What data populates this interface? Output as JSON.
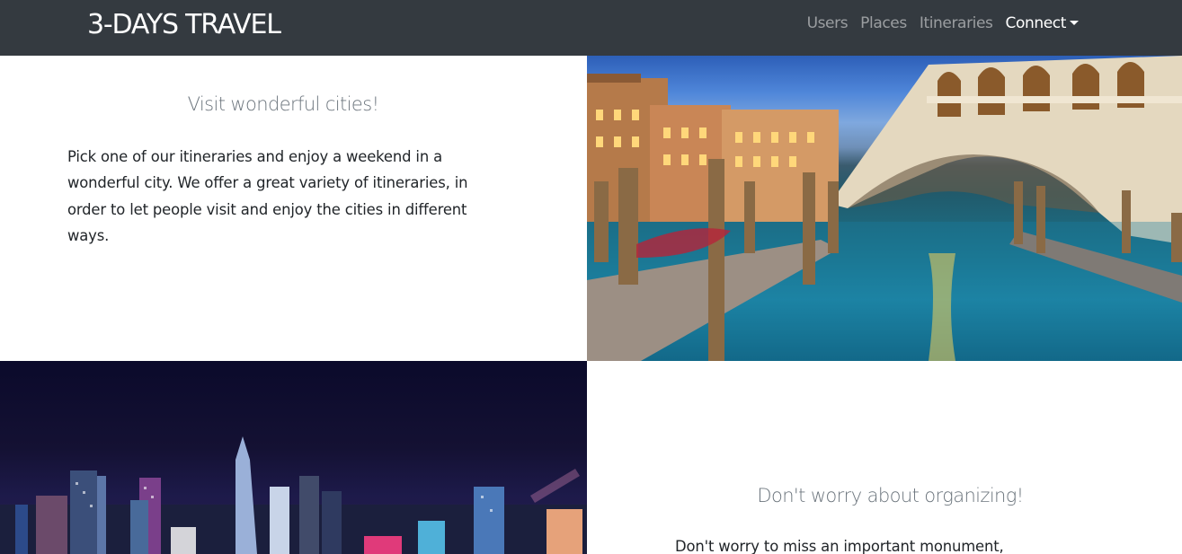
{
  "nav": {
    "brand": "3-DAYS TRAVEL",
    "links": [
      {
        "label": "Users",
        "active": false
      },
      {
        "label": "Places",
        "active": false
      },
      {
        "label": "Itineraries",
        "active": false
      },
      {
        "label": "Connect",
        "active": true,
        "dropdown": true
      }
    ]
  },
  "section1": {
    "heading": "Visit wonderful cities!",
    "text": "Pick one of our itineraries and enjoy a weekend in a wonderful city. We offer a great variety of itineraries, in order to let people visit and enjoy the cities in different ways.",
    "image": "venice-rialto-bridge-photo"
  },
  "section2": {
    "heading": "Don't worry about organizing!",
    "text": "Don't worry to miss an important monument,",
    "image": "night-city-skyline-photo"
  },
  "colors": {
    "navbar": "#343a40",
    "heading": "#6c757d",
    "body_text": "#212529"
  }
}
